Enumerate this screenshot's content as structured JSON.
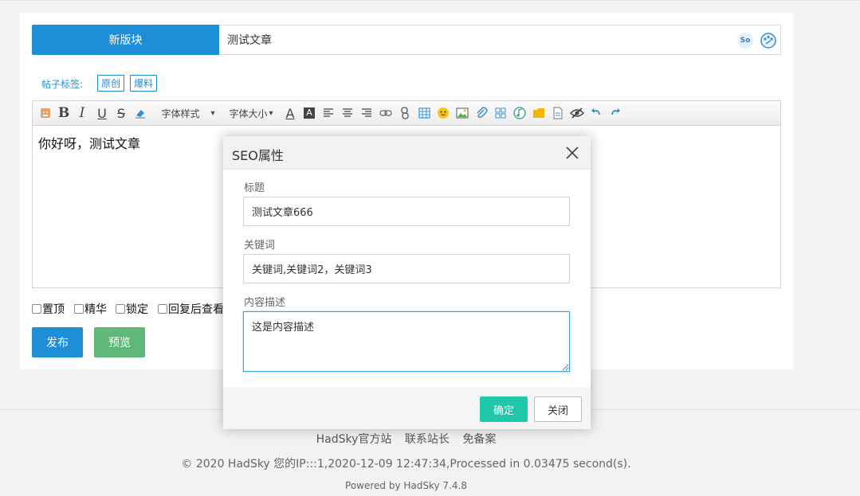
{
  "header": {
    "section_button": "新版块",
    "title_value": "测试文章",
    "seo_icon_label": "So",
    "tags_label": "帖子标签:",
    "tags": [
      "原创",
      "爆料"
    ]
  },
  "editor": {
    "font_style": "字体样式",
    "font_size": "字体大小",
    "font_style_arrow": "▾",
    "font_size_arrow": "▾",
    "tb_bold": "B",
    "tb_italic": "I",
    "tb_underline": "U",
    "tb_strike": "S",
    "tb_fontcolor": "A",
    "tb_bgcolor": "A",
    "content": "你好呀，测试文章"
  },
  "options": {
    "top": "置顶",
    "featured": "精华",
    "lock": "锁定",
    "reply_view": "回复后查看"
  },
  "actions": {
    "publish": "发布",
    "preview": "预览"
  },
  "modal": {
    "title": "SEO属性",
    "title_label": "标题",
    "title_value": "测试文章666",
    "keywords_label": "关键词",
    "keywords_value": "关键词,关键词2，关键词3",
    "description_label": "内容描述",
    "description_value": "这是内容描述",
    "ok": "确定",
    "close": "关闭"
  },
  "footer": {
    "links": [
      "HadSky官方站",
      "联系站长",
      "免备案"
    ],
    "copyright": "© 2020 HadSky 您的IP:::1,2020-12-09 12:47:34,Processed in 0.03475 second(s).",
    "powered": "Powered by HadSky 7.4.8"
  },
  "colors": {
    "primary": "#1e8fd6",
    "preview": "#5fb878",
    "confirm": "#1fc8a8"
  }
}
